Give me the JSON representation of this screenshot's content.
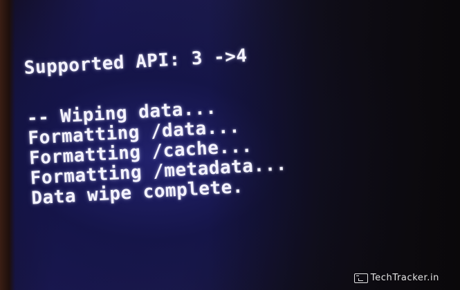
{
  "recovery_console": {
    "api_line": "Supported API: 3 ->4",
    "log_lines": [
      "-- Wiping data...",
      "Formatting /data...",
      "Formatting /cache...",
      "Formatting /metadata...",
      "Data wipe complete."
    ]
  },
  "watermark": {
    "icon": "monitor-icon",
    "text": "TechTracker.in"
  },
  "colors": {
    "screen_background": "#1b1a4a",
    "console_text": "#f4f3ff",
    "watermark_text": "#e6e6e6"
  }
}
